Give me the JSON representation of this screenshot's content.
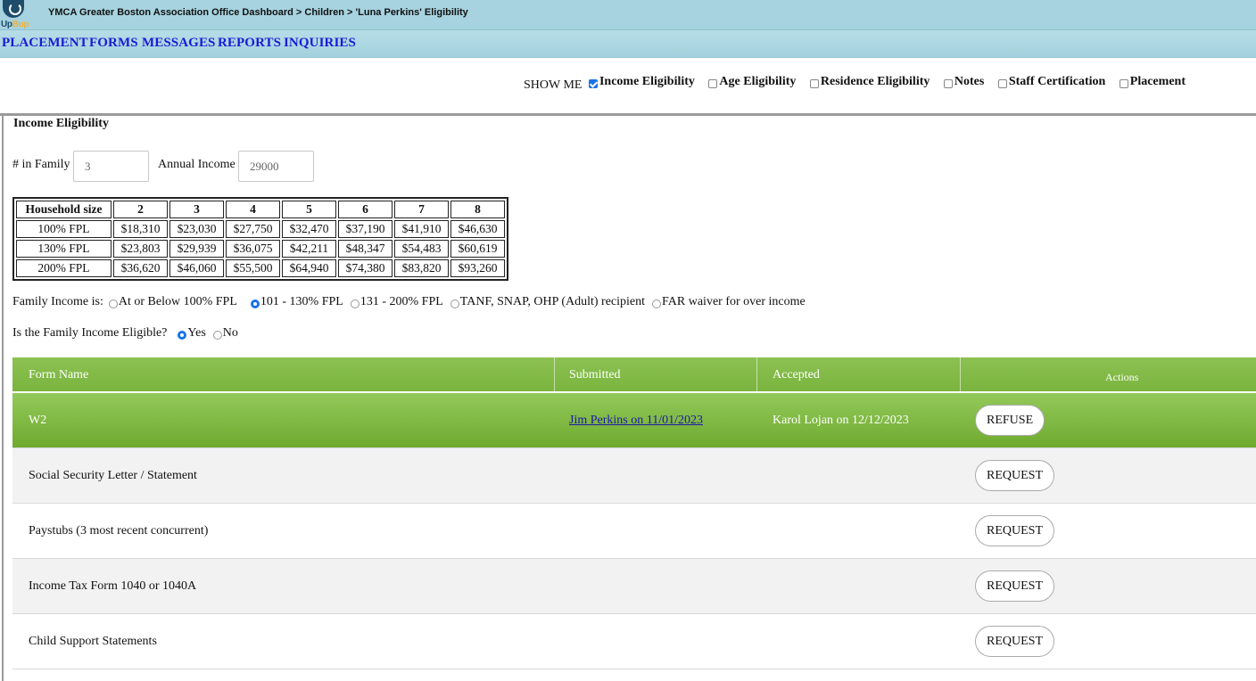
{
  "app": {
    "logo_text_a": "Up",
    "logo_text_b": "Bup"
  },
  "breadcrumb": "YMCA Greater Boston Association Office Dashboard > Children > 'Luna Perkins' Eligibility",
  "nav": [
    "PLACEMENT",
    "FORMS",
    "MESSAGES",
    "REPORTS",
    "INQUIRIES"
  ],
  "show_me": {
    "label": "SHOW ME",
    "options": [
      {
        "label": "Income Eligibility",
        "checked": true
      },
      {
        "label": "Age Eligibility",
        "checked": false
      },
      {
        "label": "Residence Eligibility",
        "checked": false
      },
      {
        "label": "Notes",
        "checked": false
      },
      {
        "label": "Staff Certification",
        "checked": false
      },
      {
        "label": "Placement",
        "checked": false
      }
    ]
  },
  "section": {
    "title": "Income Eligibility",
    "family_label": "# in Family",
    "family_value": "3",
    "income_label": "Annual Income",
    "income_value": "29000"
  },
  "fpl_table": {
    "headers": [
      "Household size",
      "2",
      "3",
      "4",
      "5",
      "6",
      "7",
      "8"
    ],
    "rows": [
      [
        "100% FPL",
        "$18,310",
        "$23,030",
        "$27,750",
        "$32,470",
        "$37,190",
        "$41,910",
        "$46,630"
      ],
      [
        "130% FPL",
        "$23,803",
        "$29,939",
        "$36,075",
        "$42,211",
        "$48,347",
        "$54,483",
        "$60,619"
      ],
      [
        "200% FPL",
        "$36,620",
        "$46,060",
        "$55,500",
        "$64,940",
        "$74,380",
        "$83,820",
        "$93,260"
      ]
    ]
  },
  "family_income": {
    "label": "Family Income is:",
    "options": [
      {
        "label": "At or Below 100% FPL",
        "selected": false
      },
      {
        "label": "101 - 130% FPL",
        "selected": true
      },
      {
        "label": "131 - 200% FPL",
        "selected": false
      },
      {
        "label": "TANF, SNAP, OHP (Adult) recipient",
        "selected": false
      },
      {
        "label": "FAR waiver for over income",
        "selected": false
      }
    ]
  },
  "eligible": {
    "label": "Is the Family Income Eligible?",
    "options": [
      {
        "label": "Yes",
        "selected": true
      },
      {
        "label": "No",
        "selected": false
      }
    ]
  },
  "forms": {
    "headers": {
      "name": "Form Name",
      "submitted": "Submitted",
      "accepted": "Accepted",
      "actions": "Actions"
    },
    "rows": [
      {
        "name": "W2",
        "submitted": "Jim Perkins on 11/01/2023",
        "accepted": "Karol Lojan on 12/12/2023",
        "action": "REFUSE"
      },
      {
        "name": "Social Security Letter / Statement",
        "submitted": "",
        "accepted": "",
        "action": "REQUEST"
      },
      {
        "name": "Paystubs (3 most recent concurrent)",
        "submitted": "",
        "accepted": "",
        "action": "REQUEST"
      },
      {
        "name": "Income Tax Form 1040 or 1040A",
        "submitted": "",
        "accepted": "",
        "action": "REQUEST"
      },
      {
        "name": "Child Support Statements",
        "submitted": "",
        "accepted": "",
        "action": "REQUEST"
      }
    ]
  }
}
